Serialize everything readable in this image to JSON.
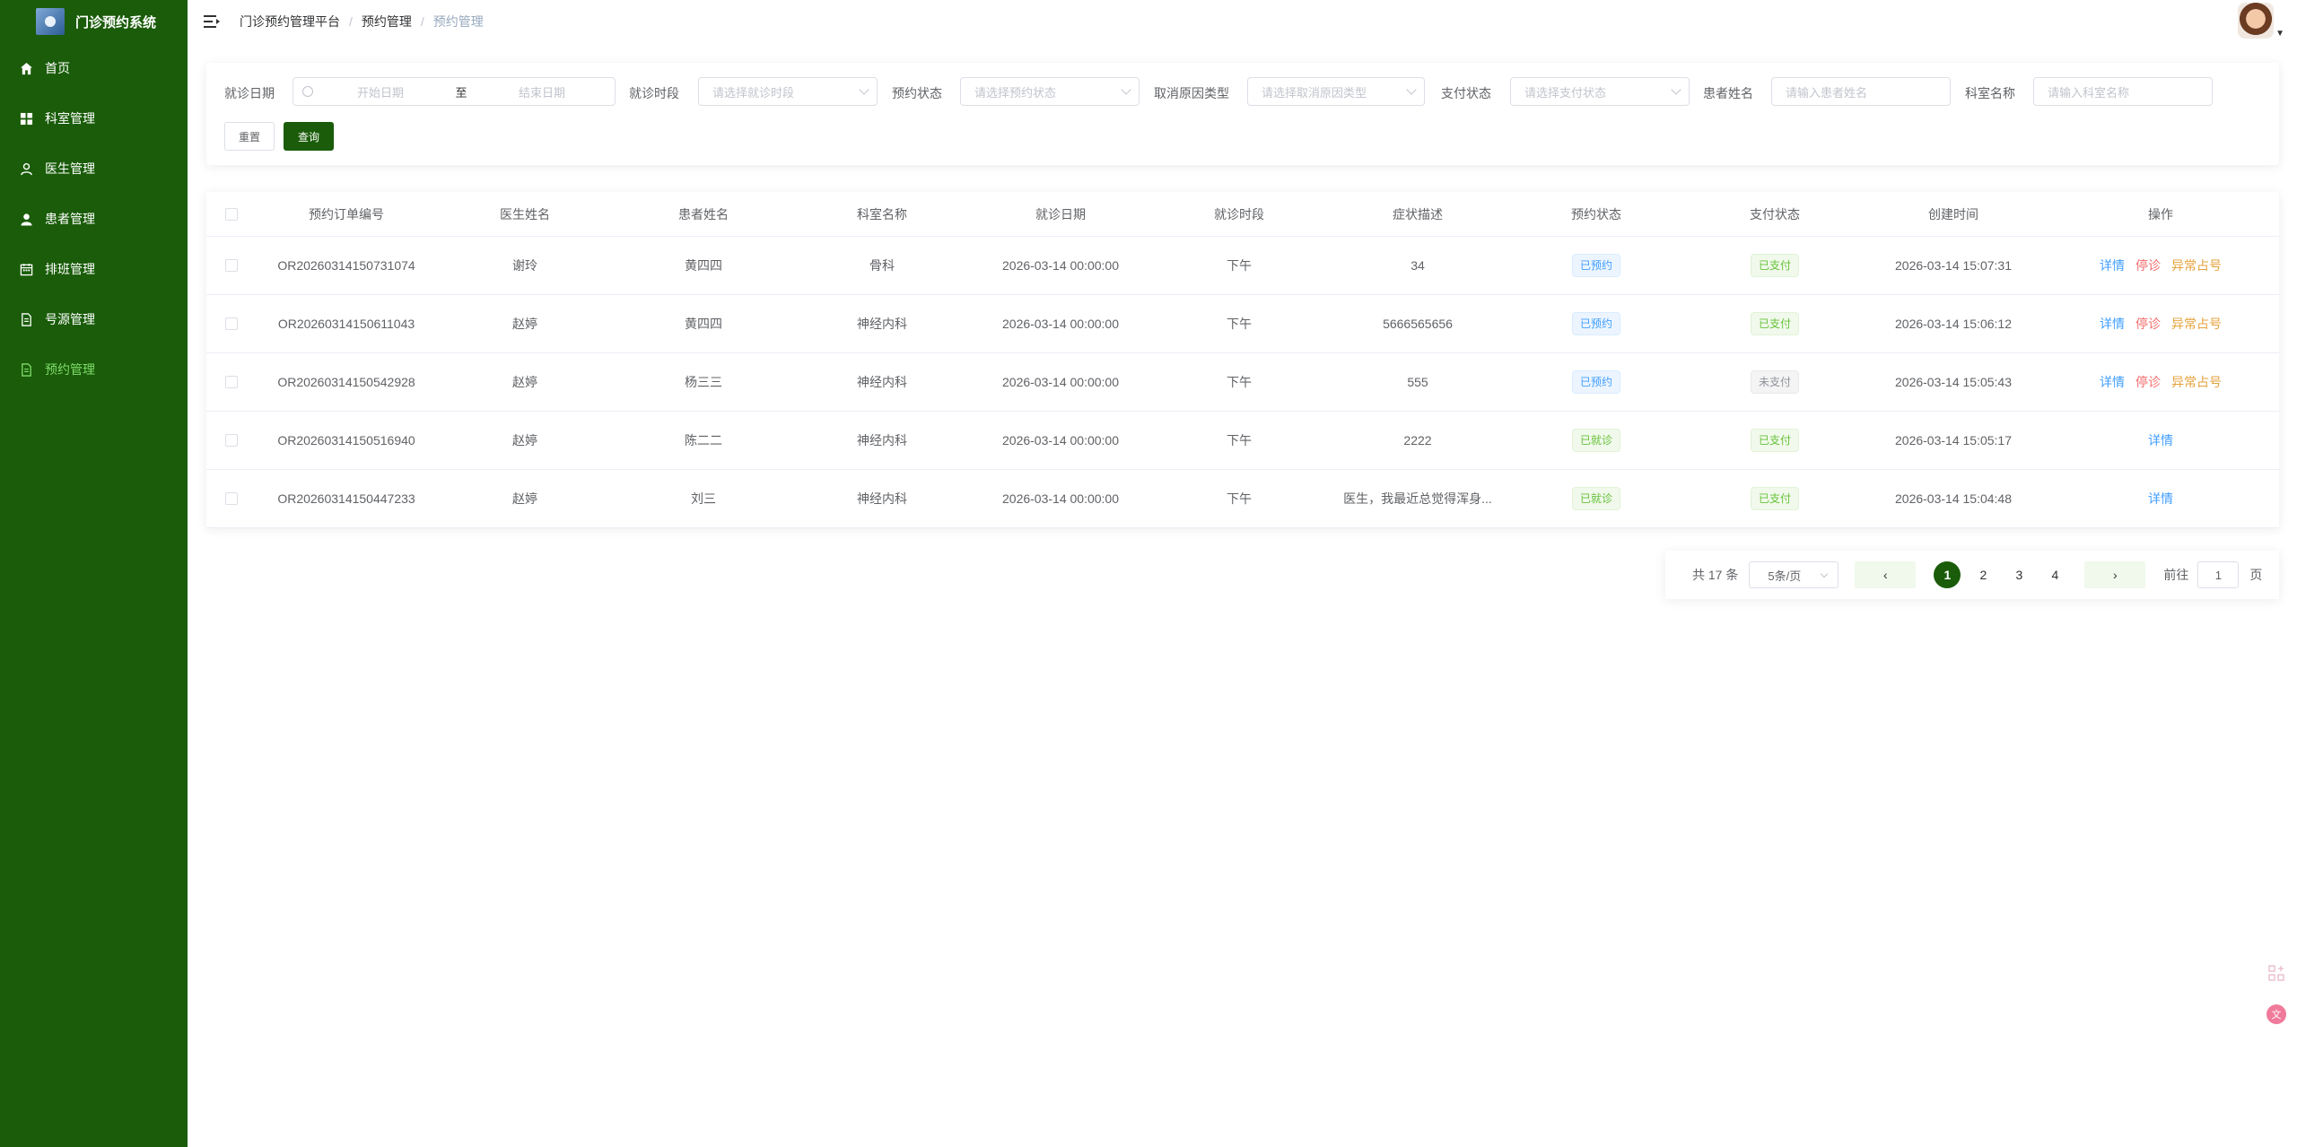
{
  "app": {
    "title": "门诊预约系统"
  },
  "sidebar": {
    "items": [
      {
        "label": "首页",
        "icon": "home-icon",
        "active": false
      },
      {
        "label": "科室管理",
        "icon": "grid-icon",
        "active": false
      },
      {
        "label": "医生管理",
        "icon": "user-outline-icon",
        "active": false
      },
      {
        "label": "患者管理",
        "icon": "user-filled-icon",
        "active": false
      },
      {
        "label": "排班管理",
        "icon": "calendar-icon",
        "active": false
      },
      {
        "label": "号源管理",
        "icon": "document-icon",
        "active": false
      },
      {
        "label": "预约管理",
        "icon": "document-icon",
        "active": true
      }
    ]
  },
  "breadcrumb": [
    "门诊预约管理平台",
    "预约管理",
    "预约管理"
  ],
  "search": {
    "date_label": "就诊日期",
    "date_start_placeholder": "开始日期",
    "date_sep": "至",
    "date_end_placeholder": "结束日期",
    "period_label": "就诊时段",
    "period_placeholder": "请选择就诊时段",
    "status_label": "预约状态",
    "status_placeholder": "请选择预约状态",
    "cancel_label": "取消原因类型",
    "cancel_placeholder": "请选择取消原因类型",
    "pay_label": "支付状态",
    "pay_placeholder": "请选择支付状态",
    "patient_label": "患者姓名",
    "patient_placeholder": "请输入患者姓名",
    "dept_label": "科室名称",
    "dept_placeholder": "请输入科室名称",
    "reset_label": "重置",
    "query_label": "查询"
  },
  "table": {
    "columns": [
      "预约订单编号",
      "医生姓名",
      "患者姓名",
      "科室名称",
      "就诊日期",
      "就诊时段",
      "症状描述",
      "预约状态",
      "支付状态",
      "创建时间",
      "操作"
    ],
    "rows": [
      {
        "order": "OR20260314150731074",
        "doctor": "谢玲",
        "patient": "黄四四",
        "dept": "骨科",
        "date": "2026-03-14 00:00:00",
        "period": "下午",
        "symptom": "34",
        "appt_status": "已预约",
        "pay_status": "已支付",
        "created": "2026-03-14 15:07:31",
        "ops": [
          "详情",
          "停诊",
          "异常占号"
        ]
      },
      {
        "order": "OR20260314150611043",
        "doctor": "赵婷",
        "patient": "黄四四",
        "dept": "神经内科",
        "date": "2026-03-14 00:00:00",
        "period": "下午",
        "symptom": "5666565656",
        "appt_status": "已预约",
        "pay_status": "已支付",
        "created": "2026-03-14 15:06:12",
        "ops": [
          "详情",
          "停诊",
          "异常占号"
        ]
      },
      {
        "order": "OR20260314150542928",
        "doctor": "赵婷",
        "patient": "杨三三",
        "dept": "神经内科",
        "date": "2026-03-14 00:00:00",
        "period": "下午",
        "symptom": "555",
        "appt_status": "已预约",
        "pay_status": "未支付",
        "created": "2026-03-14 15:05:43",
        "ops": [
          "详情",
          "停诊",
          "异常占号"
        ]
      },
      {
        "order": "OR20260314150516940",
        "doctor": "赵婷",
        "patient": "陈二二",
        "dept": "神经内科",
        "date": "2026-03-14 00:00:00",
        "period": "下午",
        "symptom": "2222",
        "appt_status": "已就诊",
        "pay_status": "已支付",
        "created": "2026-03-14 15:05:17",
        "ops": [
          "详情"
        ]
      },
      {
        "order": "OR20260314150447233",
        "doctor": "赵婷",
        "patient": "刘三",
        "dept": "神经内科",
        "date": "2026-03-14 00:00:00",
        "period": "下午",
        "symptom": "医生，我最近总觉得浑身...",
        "appt_status": "已就诊",
        "pay_status": "已支付",
        "created": "2026-03-14 15:04:48",
        "ops": [
          "详情"
        ]
      }
    ]
  },
  "pagination": {
    "total_text": "共 17 条",
    "page_size": "5条/页",
    "pages": [
      "1",
      "2",
      "3",
      "4"
    ],
    "current": "1",
    "jump_prefix": "前往",
    "jump_value": "1",
    "jump_suffix": "页"
  },
  "colors": {
    "sidebar_bg": "#1a5c09",
    "primary": "#1a5c09",
    "active_menu": "#7fdc6a",
    "link_blue": "#409eff",
    "danger": "#f56c6c",
    "warning": "#e6a23c"
  }
}
